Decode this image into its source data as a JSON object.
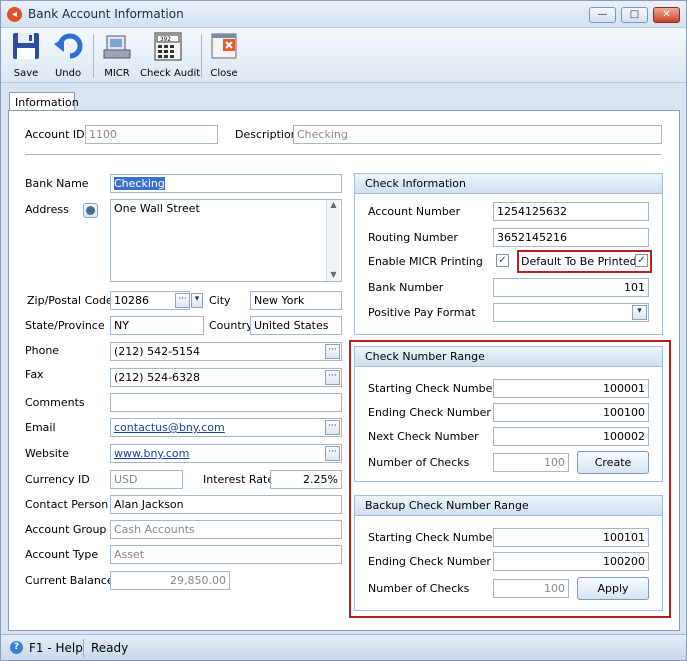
{
  "window": {
    "title": "Bank Account Information",
    "controls": {
      "minimize": "—",
      "restore": "□",
      "close": "✕"
    }
  },
  "toolbar": {
    "buttons": [
      {
        "label": "Save",
        "icon": "floppy-disk-icon"
      },
      {
        "label": "Undo",
        "icon": "undo-arrow-icon"
      },
      {
        "label": "MICR",
        "icon": "micr-printer-icon"
      },
      {
        "label": "Check Audit",
        "icon": "calculator-icon"
      },
      {
        "label": "Close",
        "icon": "close-window-icon"
      }
    ],
    "check_audit_digits": "392"
  },
  "tabs": [
    "Information"
  ],
  "header": {
    "account_id_label": "Account ID",
    "account_id": "1100",
    "description_label": "Description",
    "description": "Checking"
  },
  "left": {
    "bank_name_label": "Bank Name",
    "bank_name": "Checking",
    "address_label": "Address",
    "address": "One Wall Street",
    "zip_label": "Zip/Postal Code",
    "zip": "10286",
    "city_label": "City",
    "city": "New York",
    "state_label": "State/Province",
    "state": "NY",
    "country_label": "Country",
    "country": "United States",
    "phone_label": "Phone",
    "phone": "(212) 542-5154",
    "fax_label": "Fax",
    "fax": "(212) 524-6328",
    "comments_label": "Comments",
    "comments": "",
    "email_label": "Email",
    "email": "contactus@bny.com",
    "website_label": "Website",
    "website": "www.bny.com",
    "currency_label": "Currency ID",
    "currency": "USD",
    "interest_label": "Interest Rate",
    "interest": "2.25%",
    "contact_label": "Contact Person",
    "contact": "Alan Jackson",
    "group_label": "Account Group",
    "group": "Cash Accounts",
    "type_label": "Account Type",
    "type": "Asset",
    "balance_label": "Current Balance",
    "balance": "29,850.00"
  },
  "check_info": {
    "title": "Check Information",
    "account_number_label": "Account Number",
    "account_number": "1254125632",
    "routing_label": "Routing Number",
    "routing": "3652145216",
    "micr_label": "Enable MICR Printing",
    "micr_checked": true,
    "default_print_label": "Default To Be Printed",
    "default_print_checked": true,
    "bank_number_label": "Bank Number",
    "bank_number": "101",
    "positive_pay_label": "Positive Pay Format",
    "positive_pay": ""
  },
  "check_range": {
    "title": "Check Number Range",
    "start_label": "Starting Check Number",
    "start": "100001",
    "end_label": "Ending Check Number",
    "end": "100100",
    "next_label": "Next Check Number",
    "next": "100002",
    "count_label": "Number of Checks",
    "count": "100",
    "button": "Create"
  },
  "backup_range": {
    "title": "Backup Check Number Range",
    "start_label": "Starting Check Number",
    "start": "100101",
    "end_label": "Ending Check Number",
    "end": "100200",
    "count_label": "Number of Checks",
    "count": "100",
    "button": "Apply"
  },
  "status": {
    "help": "F1 - Help",
    "state": "Ready"
  },
  "colors": {
    "accent_red": "#b22222",
    "link_blue": "#1a3fa8",
    "frame_blue": "#d8e4f2"
  }
}
